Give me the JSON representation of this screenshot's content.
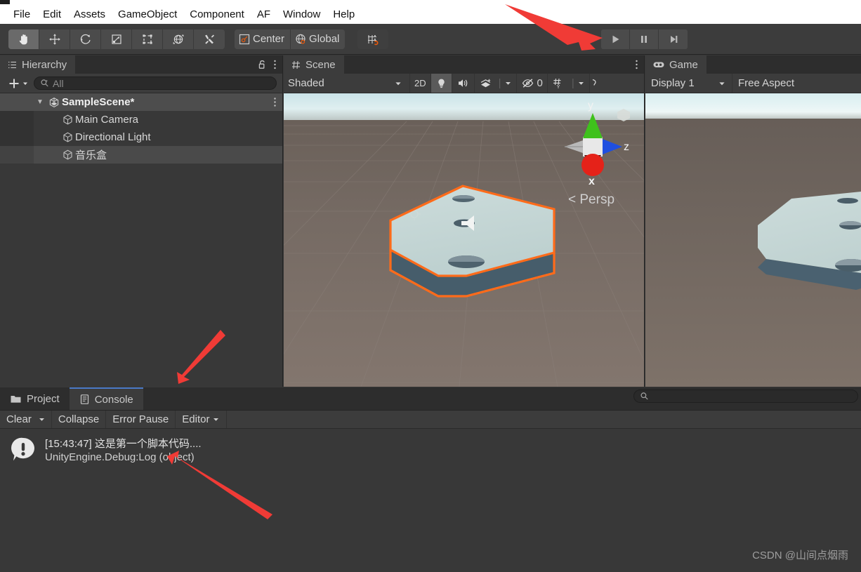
{
  "window": {
    "title_partial": ""
  },
  "menubar": {
    "items": [
      {
        "label": "File"
      },
      {
        "label": "Edit"
      },
      {
        "label": "Assets"
      },
      {
        "label": "GameObject"
      },
      {
        "label": "Component"
      },
      {
        "label": "AF"
      },
      {
        "label": "Window"
      },
      {
        "label": "Help"
      }
    ]
  },
  "toolbar": {
    "tools": [
      {
        "name": "hand-tool",
        "active": true
      },
      {
        "name": "move-tool",
        "active": false
      },
      {
        "name": "rotate-tool",
        "active": false
      },
      {
        "name": "scale-tool",
        "active": false
      },
      {
        "name": "rect-tool",
        "active": false
      },
      {
        "name": "transform-tool",
        "active": false
      },
      {
        "name": "custom-tool",
        "active": false
      }
    ],
    "pivot_label": "Center",
    "space_label": "Global",
    "snap_tooltip": "Grid Snapping",
    "play_label": "Play",
    "pause_label": "Pause",
    "step_label": "Step"
  },
  "hierarchy": {
    "tab_label": "Hierarchy",
    "search_placeholder": "All",
    "search_value": "",
    "add_label": "+",
    "rows": [
      {
        "label": "SampleScene*",
        "icon": "unity-scene-icon",
        "depth": 0,
        "type": "scene",
        "expanded": true,
        "selected": false
      },
      {
        "label": "Main Camera",
        "icon": "gameobject-cube-icon",
        "depth": 1,
        "type": "object",
        "selected": false
      },
      {
        "label": "Directional Light",
        "icon": "gameobject-cube-icon",
        "depth": 1,
        "type": "object",
        "selected": false
      },
      {
        "label": "音乐盒",
        "icon": "gameobject-cube-icon",
        "depth": 1,
        "type": "object",
        "selected": true
      }
    ]
  },
  "scene": {
    "tab_label": "Scene",
    "draw_mode": "Shaded",
    "mode_2d": "2D",
    "hidden_count": "0",
    "gizmo": {
      "axis_x": "x",
      "axis_y": "y",
      "axis_z": "z",
      "projection": "Persp",
      "projection_prefix": "<"
    },
    "toolbar_items": [
      {
        "name": "lighting-toggle",
        "on": true
      },
      {
        "name": "audio-toggle",
        "on": false
      },
      {
        "name": "fx-dropdown",
        "on": false
      },
      {
        "name": "hidden-objects-toggle",
        "on": false
      },
      {
        "name": "grid-dropdown",
        "on": false
      },
      {
        "name": "scene-vis-overflow",
        "on": false
      }
    ]
  },
  "game": {
    "tab_label": "Game",
    "display_label": "Display 1",
    "aspect_label": "Free Aspect"
  },
  "console": {
    "project_tab": "Project",
    "console_tab": "Console",
    "clear_label": "Clear",
    "collapse_label": "Collapse",
    "error_pause_label": "Error Pause",
    "editor_label": "Editor",
    "search_placeholder": "",
    "search_value": "",
    "entries": [
      {
        "icon": "info-log-icon",
        "line1": "[15:43:47] 这是第一个脚本代码....",
        "line2": "UnityEngine.Debug:Log (object)"
      }
    ]
  },
  "watermark": {
    "text": "CSDN @山间点烟雨"
  },
  "colors": {
    "accent_orange": "#e8590c",
    "selection_outline": "#ff6b1a",
    "tab_active_underline": "#4a79c7",
    "panel_bg": "#383838",
    "toolbar_bg": "#3c3c3c",
    "annotation_red": "#f03b36"
  }
}
